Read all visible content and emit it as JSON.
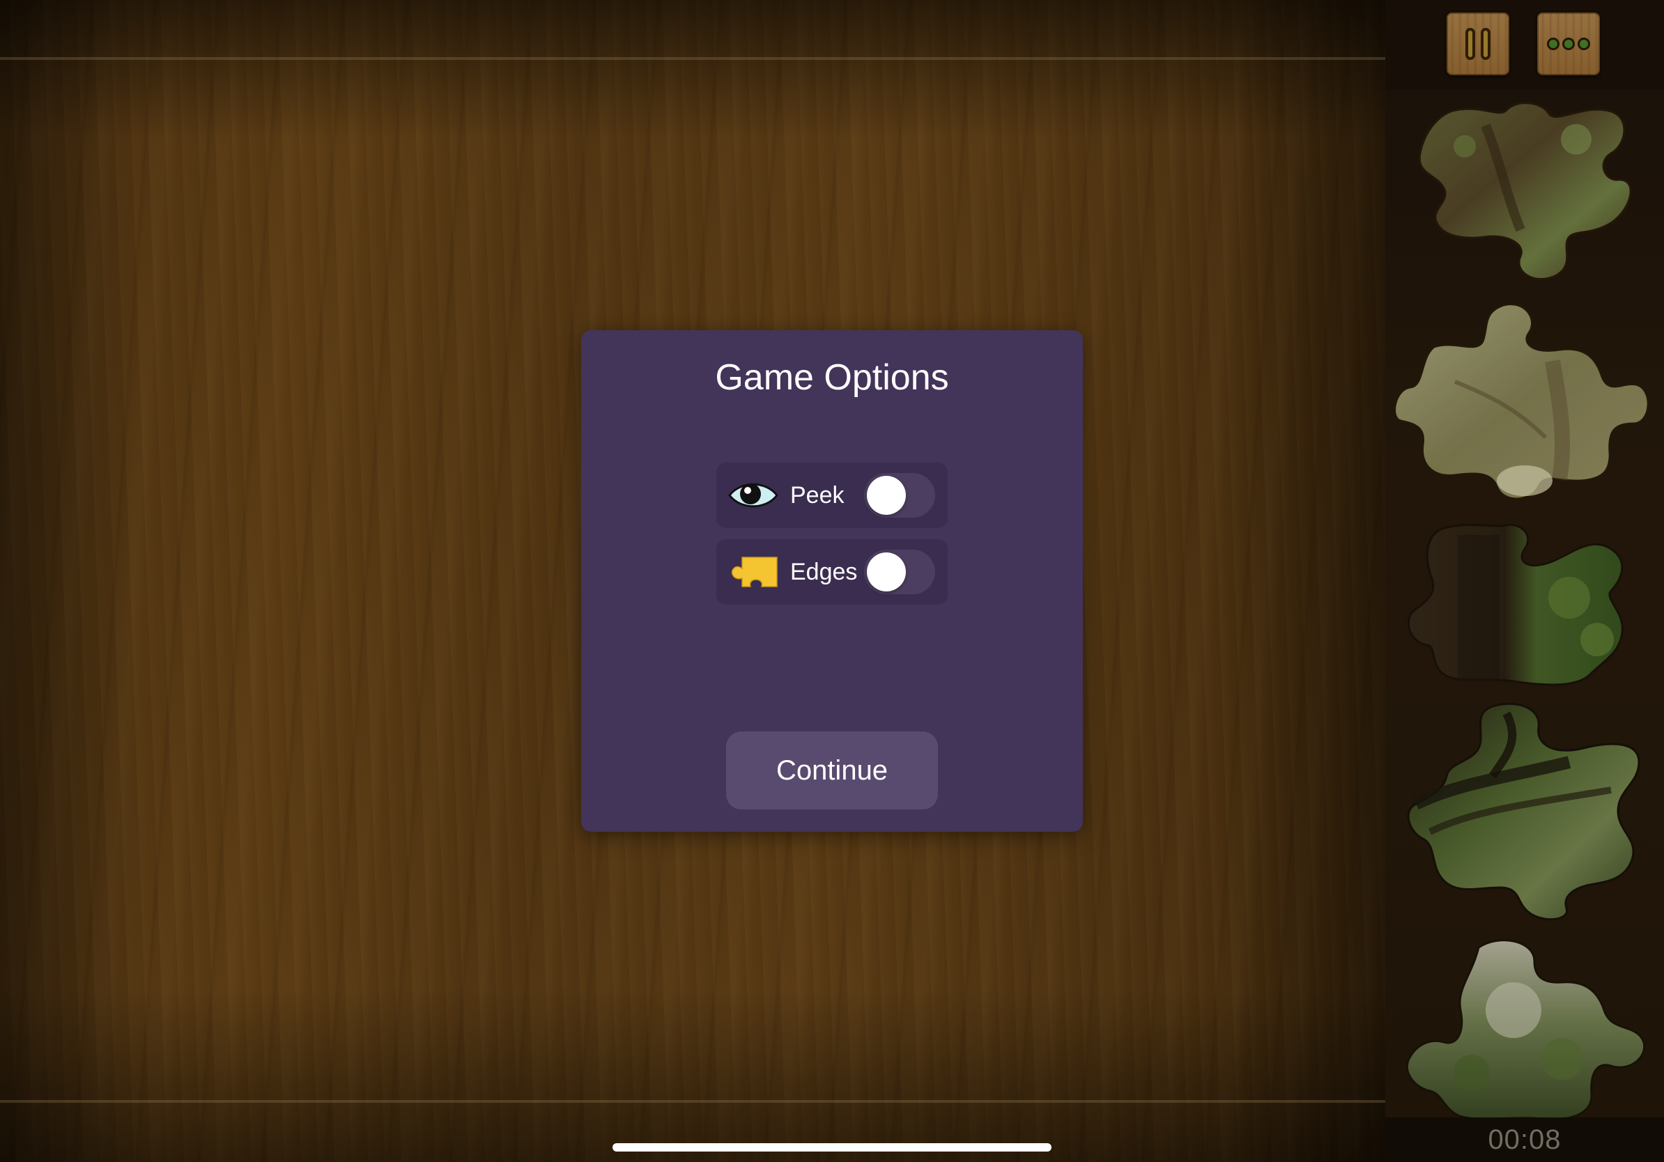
{
  "modal": {
    "title": "Game Options",
    "options": [
      {
        "label": "Peek",
        "icon": "eye-icon",
        "enabled": false
      },
      {
        "label": "Edges",
        "icon": "edge-piece-icon",
        "enabled": false
      }
    ],
    "continue_label": "Continue"
  },
  "sidebar": {
    "pause_icon": "pause-icon",
    "more_icon": "more-dots-icon",
    "piece_count": 5,
    "timer": "00:08"
  },
  "colors": {
    "modal_bg": "#433459",
    "row_bg": "#3a2d4f",
    "button_bg": "#594b6f",
    "edge_icon": "#f5c431"
  }
}
